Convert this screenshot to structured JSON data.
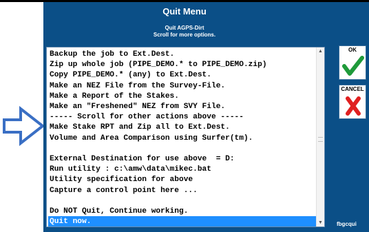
{
  "title": "Quit Menu",
  "subtitle_line1": "Quit AGPS-Dirt",
  "subtitle_line2": "Scroll for more options.",
  "items": [
    "Backup the job to Ext.Dest.",
    "Zip up whole job (PIPE_DEMO.* to PIPE_DEMO.zip)",
    "Copy PIPE_DEMO.* (any) to Ext.Dest.",
    "Make an NEZ File from the Survey-File.",
    "Make a Report of the Stakes.",
    "Make an \"Freshened\" NEZ from SVY File.",
    "----- Scroll for other actions above -----",
    "Make Stake RPT and Zip all to Ext.Dest.",
    "Volume and Area Comparison using Surfer(tm).",
    "",
    "External Destination for use above  = D:",
    "Run utility : c:\\amw\\data\\mikec.bat",
    "Utility specification for above",
    "Capture a control point here ...",
    "",
    "Do NOT Quit, Continue working.",
    "Quit now."
  ],
  "selected_index": 16,
  "ok_label": "OK",
  "cancel_label": "CANCEL",
  "footer_text": "fbgcqui",
  "colors": {
    "panel": "#0b4f87",
    "selection": "#1e8fff",
    "ok_check": "#1f9a3a",
    "cancel_x": "#e02020",
    "arrow": "#3a6fc4"
  }
}
